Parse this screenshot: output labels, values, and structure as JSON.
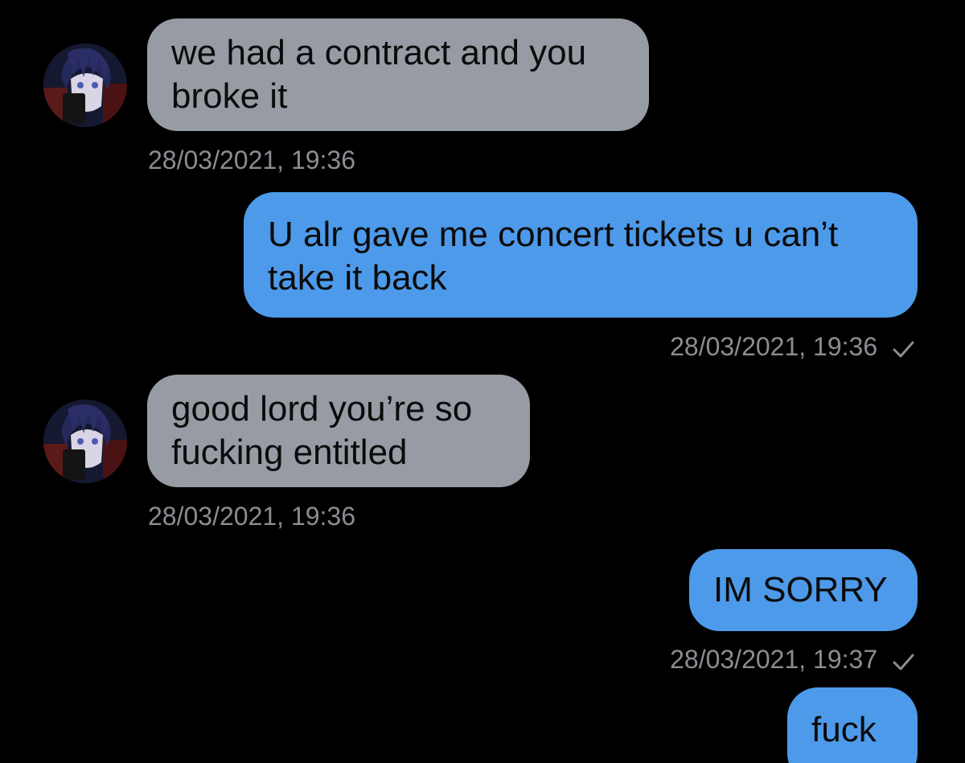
{
  "messages": [
    {
      "direction": "incoming",
      "text": "we had a contract and you broke it",
      "timestamp": "28/03/2021, 19:36"
    },
    {
      "direction": "outgoing",
      "text": "U alr gave me concert tickets u can’t take it back",
      "timestamp": "28/03/2021, 19:36",
      "status_icon": "checkmark-icon"
    },
    {
      "direction": "incoming",
      "text": "good lord you’re so fucking entitled",
      "timestamp": "28/03/2021, 19:36"
    },
    {
      "direction": "outgoing",
      "text": "IM SORRY",
      "timestamp": "28/03/2021, 19:37",
      "status_icon": "checkmark-icon"
    },
    {
      "direction": "outgoing",
      "text": "fuck",
      "timestamp": "",
      "status_icon": ""
    }
  ],
  "colors": {
    "background": "#000000",
    "incoming_bubble": "#979ba3",
    "outgoing_bubble": "#4d9aea",
    "timestamp_text": "#8a8d92"
  },
  "icons": {
    "contact_avatar": "avatar-icon",
    "delivered": "checkmark-icon"
  }
}
